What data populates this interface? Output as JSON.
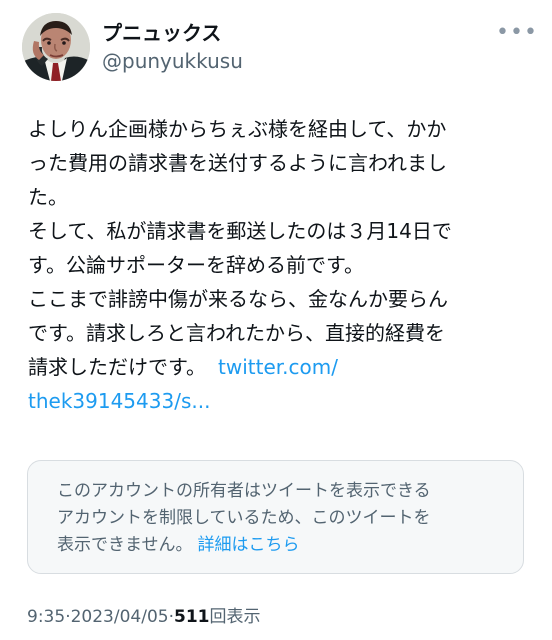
{
  "author": {
    "display_name": "プニュックス",
    "handle": "@punyukkusu",
    "avatar_icon": "man-on-phone-avatar"
  },
  "more_icon": "ellipsis-horizontal-icon",
  "tweet": {
    "lines": [
      "よしりん企画様からちぇぶ様を経由して、かか",
      "った費用の請求書を送付するように言われまし",
      "た。",
      "そして、私が請求書を郵送したのは３月14日で",
      "す。公論サポーターを辞める前です。",
      "ここまで誹謗中傷が来るなら、金なんか要らん",
      "です。請求しろと言われたから、直接的経費を"
    ],
    "last_line_text": "請求しただけです。",
    "link_part_1": "twitter.com/",
    "link_part_2": "thek39145433/s..."
  },
  "notice": {
    "line_1": "このアカウントの所有者はツイートを表示できる",
    "line_2": "アカウントを制限しているため、このツイートを",
    "line_3": "表示できません。",
    "link_label": "詳細はこちら"
  },
  "meta": {
    "time": "9:35",
    "separator_1": " · ",
    "date": "2023/04/05",
    "separator_2": " · ",
    "views_count": "511",
    "views_label": "回表示"
  },
  "colors": {
    "text": "#0f1419",
    "muted": "#536471",
    "link": "#1d9bf0",
    "notice_background": "#f6f8f9",
    "notice_border": "#d8dde1"
  }
}
